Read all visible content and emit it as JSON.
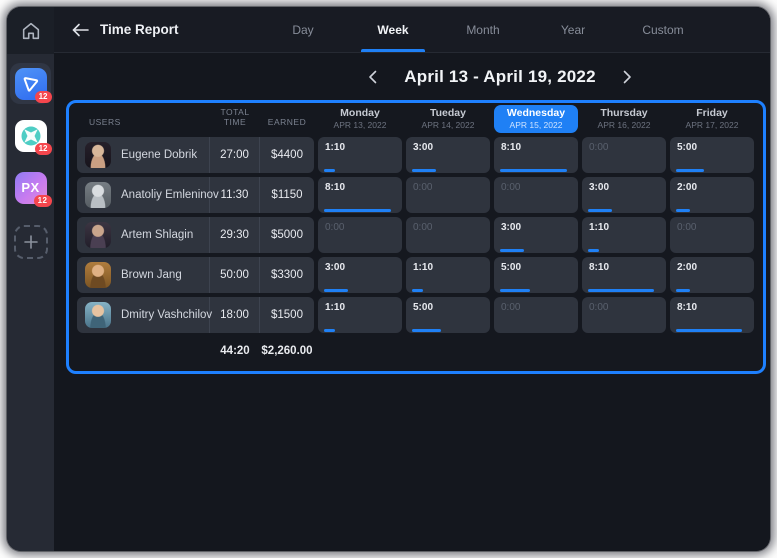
{
  "colors": {
    "accent": "#1f80f5",
    "badge_red": "#f5464d",
    "container_border": "#1e80ff"
  },
  "sidebar": {
    "apps": [
      {
        "id": "triangle-app",
        "style": "blue",
        "badge": "12",
        "active": true,
        "label": ""
      },
      {
        "id": "circle-x-app",
        "style": "teal",
        "badge": "12",
        "active": false,
        "label": ""
      },
      {
        "id": "px-app",
        "style": "px",
        "badge": "12",
        "active": false,
        "label": "PX"
      }
    ]
  },
  "header": {
    "title": "Time Report",
    "tabs": [
      {
        "label": "Day",
        "active": false
      },
      {
        "label": "Week",
        "active": true
      },
      {
        "label": "Month",
        "active": false
      },
      {
        "label": "Year",
        "active": false
      },
      {
        "label": "Custom",
        "active": false
      }
    ]
  },
  "date_nav": {
    "label": "April 13 - April 19, 2022"
  },
  "table": {
    "columns": {
      "users": "USERS",
      "total_time": "TOTAL TIME",
      "earned": "EARNED"
    },
    "days": [
      {
        "name": "Monday",
        "date": "APR 13, 2022",
        "active": false
      },
      {
        "name": "Tueday",
        "date": "APR 14, 2022",
        "active": false
      },
      {
        "name": "Wednesday",
        "date": "APR 15, 2022",
        "active": true
      },
      {
        "name": "Thursday",
        "date": "APR 16, 2022",
        "active": false
      },
      {
        "name": "Friday",
        "date": "APR 17, 2022",
        "active": false
      }
    ],
    "rows": [
      {
        "user": "Eugene Dobrik",
        "total": "27:00",
        "earned": "$4400",
        "cells": [
          {
            "time": "1:10",
            "bar": 13
          },
          {
            "time": "3:00",
            "bar": 28
          },
          {
            "time": "8:10",
            "bar": 80
          },
          {
            "time": "0:00",
            "bar": 0
          },
          {
            "time": "5:00",
            "bar": 33
          }
        ]
      },
      {
        "user": "Anatoliy Emleninov",
        "total": "11:30",
        "earned": "$1150",
        "cells": [
          {
            "time": "8:10",
            "bar": 80
          },
          {
            "time": "0:00",
            "bar": 0
          },
          {
            "time": "0:00",
            "bar": 0
          },
          {
            "time": "3:00",
            "bar": 28
          },
          {
            "time": "2:00",
            "bar": 17
          }
        ]
      },
      {
        "user": "Artem Shlagin",
        "total": "29:30",
        "earned": "$5000",
        "cells": [
          {
            "time": "0:00",
            "bar": 0
          },
          {
            "time": "0:00",
            "bar": 0
          },
          {
            "time": "3:00",
            "bar": 28
          },
          {
            "time": "1:10",
            "bar": 13
          },
          {
            "time": "0:00",
            "bar": 0
          }
        ]
      },
      {
        "user": "Brown Jang",
        "total": "50:00",
        "earned": "$3300",
        "cells": [
          {
            "time": "3:00",
            "bar": 28
          },
          {
            "time": "1:10",
            "bar": 13
          },
          {
            "time": "5:00",
            "bar": 36
          },
          {
            "time": "8:10",
            "bar": 78
          },
          {
            "time": "2:00",
            "bar": 17
          }
        ]
      },
      {
        "user": "Dmitry Vashchilov",
        "total": "18:00",
        "earned": "$1500",
        "cells": [
          {
            "time": "1:10",
            "bar": 13
          },
          {
            "time": "5:00",
            "bar": 35
          },
          {
            "time": "0:00",
            "bar": 0
          },
          {
            "time": "0:00",
            "bar": 0
          },
          {
            "time": "8:10",
            "bar": 78
          }
        ]
      }
    ],
    "footer": {
      "total": "44:20",
      "earned": "$2,260.00"
    }
  }
}
